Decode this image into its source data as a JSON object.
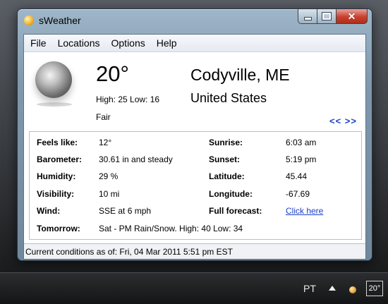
{
  "window": {
    "title": "sWeather"
  },
  "menu": [
    "File",
    "Locations",
    "Options",
    "Help"
  ],
  "current": {
    "temperature": "20°",
    "high_low": "High: 25 Low: 16",
    "condition": "Fair",
    "city": "Codyville, ME",
    "country": "United States",
    "nav": "<< >>"
  },
  "details": {
    "feels_like": {
      "label": "Feels like:",
      "value": "12°"
    },
    "barometer": {
      "label": "Barometer:",
      "value": "30.61 in and steady"
    },
    "humidity": {
      "label": "Humidity:",
      "value": "29 %"
    },
    "visibility": {
      "label": "Visibility:",
      "value": "10 mi"
    },
    "wind": {
      "label": "Wind:",
      "value": "SSE at 6 mph"
    },
    "tomorrow": {
      "label": "Tomorrow:",
      "value": "Sat - PM Rain/Snow. High: 40 Low: 34"
    },
    "sunrise": {
      "label": "Sunrise:",
      "value": "6:03 am"
    },
    "sunset": {
      "label": "Sunset:",
      "value": "5:19 pm"
    },
    "latitude": {
      "label": "Latitude:",
      "value": "45.44"
    },
    "longitude": {
      "label": "Longitude:",
      "value": "-67.69"
    },
    "forecast": {
      "label": "Full forecast:",
      "link": "Click here"
    }
  },
  "status": "Current conditions as of: Fri, 04 Mar 2011 5:51 pm EST",
  "taskbar": {
    "language": "PT",
    "tray_temp": "20°"
  },
  "colors": {
    "link": "#1a3fc7",
    "close": "#c8402e"
  }
}
